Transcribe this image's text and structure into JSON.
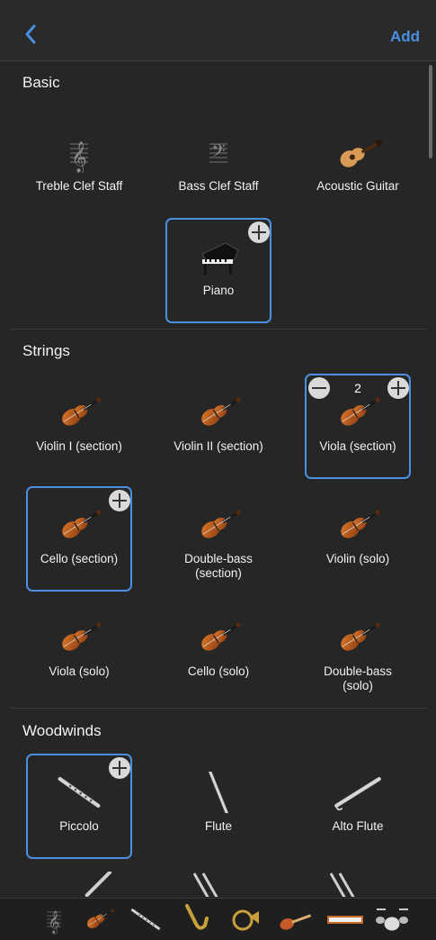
{
  "header": {
    "add_label": "Add"
  },
  "sections": {
    "basic": {
      "title": "Basic",
      "items": [
        "Treble Clef Staff",
        "Bass Clef Staff",
        "Acoustic Guitar",
        "Piano"
      ]
    },
    "strings": {
      "title": "Strings",
      "items": [
        "Violin I (section)",
        "Violin II (section)",
        "Viola (section)",
        "Cello (section)",
        "Double-bass (section)",
        "Violin (solo)",
        "Viola (solo)",
        "Cello (solo)",
        "Double-bass (solo)"
      ],
      "viola_count": "2"
    },
    "woodwinds": {
      "title": "Woodwinds",
      "items": [
        "Piccolo",
        "Flute",
        "Alto Flute"
      ]
    }
  },
  "bottom_tabs": [
    "treble-clef-icon",
    "violin-icon",
    "flute-icon",
    "saxophone-icon",
    "french-horn-icon",
    "electric-guitar-icon",
    "keyboard-icon",
    "drum-kit-icon"
  ],
  "colors": {
    "accent": "#4a90e2",
    "background": "#262626"
  }
}
